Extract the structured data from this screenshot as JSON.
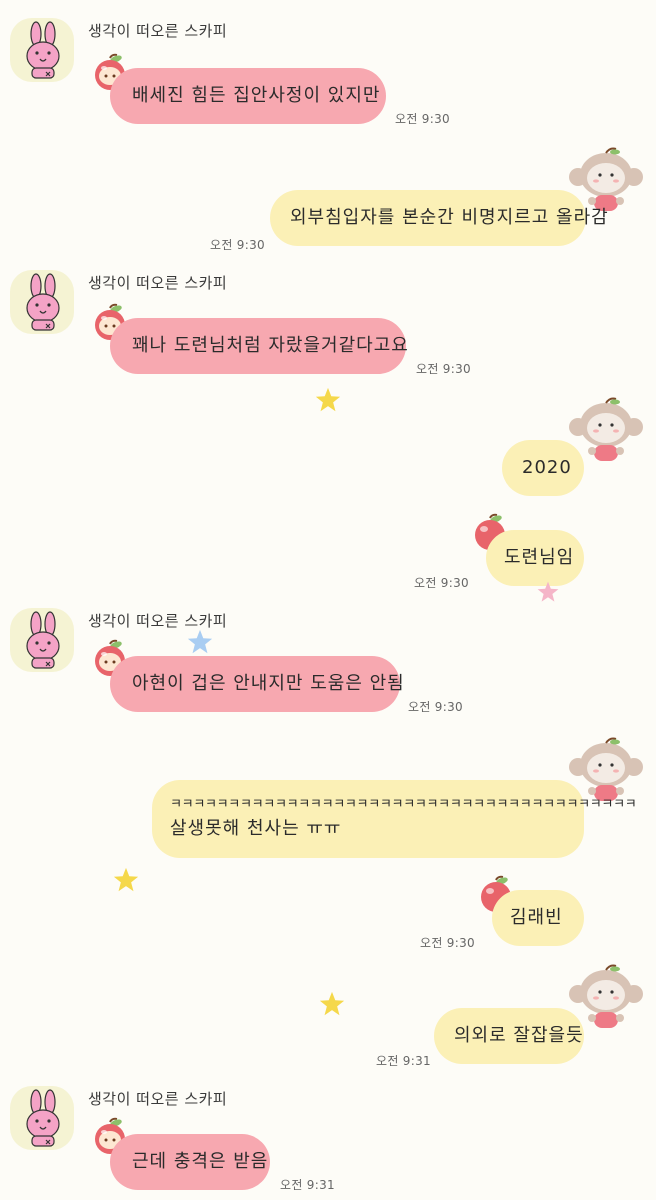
{
  "chat": {
    "sender_name": "생각이 떠오른 스카피",
    "messages": [
      {
        "from": "other",
        "text": "배세진 힘든 집안사정이 있지만",
        "time": "오전 9:30"
      },
      {
        "from": "me",
        "text": "외부침입자를 본순간 비명지르고 올라감",
        "time": "오전 9:30"
      },
      {
        "from": "other",
        "text": "꽤나 도련님처럼 자랐을거같다고요",
        "time": "오전 9:30"
      },
      {
        "from": "me",
        "text": "2020",
        "time": ""
      },
      {
        "from": "me",
        "text": "도련님임",
        "time": "오전 9:30"
      },
      {
        "from": "other",
        "text": "아현이 겁은 안내지만 도움은 안됨",
        "time": "오전 9:30"
      },
      {
        "from": "me",
        "text": "ㅋㅋㅋㅋㅋㅋㅋㅋㅋㅋㅋㅋㅋㅋㅋㅋㅋㅋㅋㅋㅋㅋㅋㅋㅋㅋㅋㅋㅋㅋㅋㅋㅋㅋㅋㅋㅋㅋㅋㅋ",
        "text2": "살생못해 천사는 ㅠㅠ",
        "time": ""
      },
      {
        "from": "me",
        "text": "김래빈",
        "time": "오전 9:30"
      },
      {
        "from": "me",
        "text": "의외로 잘잡을듯",
        "time": "오전 9:31"
      },
      {
        "from": "other",
        "text": "근데 충격은 받음",
        "time": "오전 9:31"
      }
    ]
  },
  "icons": {
    "avatar": "pink-rabbit-icon",
    "sticker_other": "apple-icon",
    "sticker_me": "monkey-icon",
    "decoration": "star-icon"
  },
  "colors": {
    "background": "#fdfcf7",
    "other_bubble": "#f7a8b0",
    "my_bubble": "#fbf0b6",
    "avatar_bg": "#f5f3d3"
  }
}
